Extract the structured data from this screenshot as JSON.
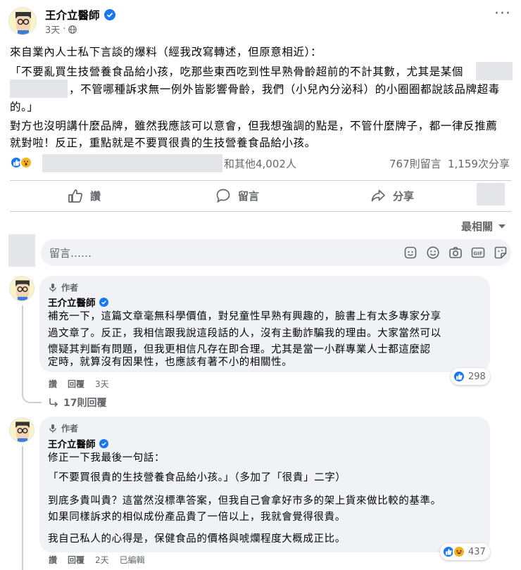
{
  "post": {
    "author": "王介立醫師",
    "time": "3天",
    "text_lines": [
      "來自業內人士私下言談的爆料（經我改寫轉述，但原意相近）：",
      "「不要亂買生技營養食品給小孩，吃那些東西吃到性早熟骨齡超前的不計其數，尤其是某個",
      "，不管哪種訴求無一例外皆影響骨齡，我們（小兒內分泌科）的小圈圈都說該品牌超毒",
      "的。」",
      "對方也沒明講什麼品牌，雖然我應該可以意會，但我想強調的點是，不管什麼牌子，都一律反推薦",
      "就對啦！反正，重點就是不要買很貴的生技營養食品給小孩。"
    ],
    "reactions_text": "和其他4,002人",
    "comments_count": "767則留言",
    "shares_count": "1,159次分享"
  },
  "actions": {
    "like": "讚",
    "comment": "留言",
    "share": "分享"
  },
  "sort_label": "最相關",
  "composer": {
    "placeholder": "留言……"
  },
  "comments": [
    {
      "badge": "作者",
      "author": "王介立醫師",
      "lines": [
        "補充一下，這篇文章毫無科學價值，對兒童性早熟有興趣的，臉書上有太多專家分享",
        "過文章了。反正，我相信跟我說這段話的人，沒有主動詐騙我的理由。大家當然可以",
        "懷疑其判斷有問題，但我更相信凡存在即合理。尤其是當一小群專業人士都這麼認",
        "定時，就算沒有因果性，也應該有著不小的相關性。"
      ],
      "like": "讚",
      "reply": "回覆",
      "time": "3天",
      "reaction_count": "298",
      "replies_label": "17則回覆"
    },
    {
      "badge": "作者",
      "author": "王介立醫師",
      "lines": [
        "修正一下我最後一句話：",
        "「不要買很貴的生技營養食品給小孩。」（多加了「很貴」二字）",
        "到底多貴叫貴？這當然沒標準答案，但我自己會拿好市多的架上貨來做比較的基準。",
        "如果同樣訴求的相似成份產品貴了一倍以上，我就會覺得很貴。",
        "我自己私人的心得是，保健食品的價格與唬爛程度大概成正比。"
      ],
      "like": "讚",
      "reply": "回覆",
      "time": "2天",
      "edited": "已編輯",
      "reaction_count": "437"
    }
  ],
  "colors": {
    "facebook_blue": "#1877f2",
    "like_blue": "#1877f2",
    "haha_yellow": "#f7b125",
    "muted": "#65676b"
  }
}
